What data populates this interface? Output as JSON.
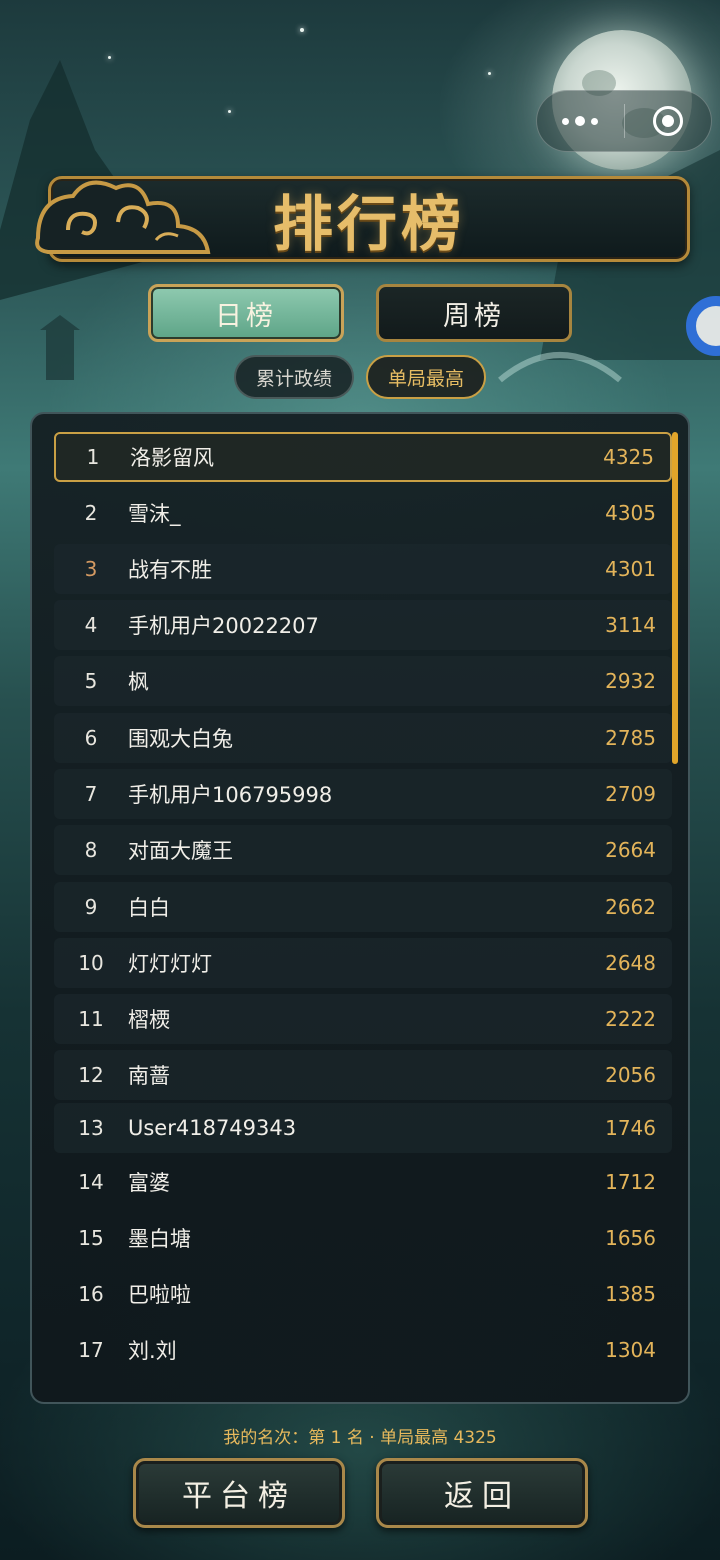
{
  "header": {
    "title": "排行榜"
  },
  "capsule": {
    "more_icon": "more-dots-icon",
    "close_icon": "target-close-icon"
  },
  "period_tabs": [
    {
      "label": "日榜",
      "selected": true
    },
    {
      "label": "周榜",
      "selected": false
    }
  ],
  "metric_tabs": [
    {
      "label": "累计政绩",
      "selected": false
    },
    {
      "label": "单局最高",
      "selected": true
    }
  ],
  "leaderboard": [
    {
      "rank": "1",
      "name": "洛影留风",
      "score": "4325"
    },
    {
      "rank": "2",
      "name": "雪沫_",
      "score": "4305"
    },
    {
      "rank": "3",
      "name": "战有不胜",
      "score": "4301"
    },
    {
      "rank": "4",
      "name": "手机用户20022207",
      "score": "3114"
    },
    {
      "rank": "5",
      "name": "枫",
      "score": "2932"
    },
    {
      "rank": "6",
      "name": "围观大白兔",
      "score": "2785"
    },
    {
      "rank": "7",
      "name": "手机用户106795998",
      "score": "2709"
    },
    {
      "rank": "8",
      "name": "对面大魔王",
      "score": "2664"
    },
    {
      "rank": "9",
      "name": "白白",
      "score": "2662"
    },
    {
      "rank": "10",
      "name": "灯灯灯灯",
      "score": "2648"
    },
    {
      "rank": "11",
      "name": "槢樮",
      "score": "2222"
    },
    {
      "rank": "12",
      "name": "南蔷",
      "score": "2056"
    },
    {
      "rank": "13",
      "name": "User418749343",
      "score": "1746"
    },
    {
      "rank": "14",
      "name": "富婆",
      "score": "1712"
    },
    {
      "rank": "15",
      "name": "墨白塘",
      "score": "1656"
    },
    {
      "rank": "16",
      "name": "巴啦啦",
      "score": "1385"
    },
    {
      "rank": "17",
      "name": "刘.刘",
      "score": "1304"
    }
  ],
  "footer": {
    "my_rank_text": "我的名次：第 1 名 · 单局最高 4325",
    "platform_button": "平台榜",
    "back_button": "返回"
  },
  "colors": {
    "accent_gold": "#e3b45a",
    "selected_tab": "#6fb395",
    "rank_bronze": "#d49a62"
  }
}
